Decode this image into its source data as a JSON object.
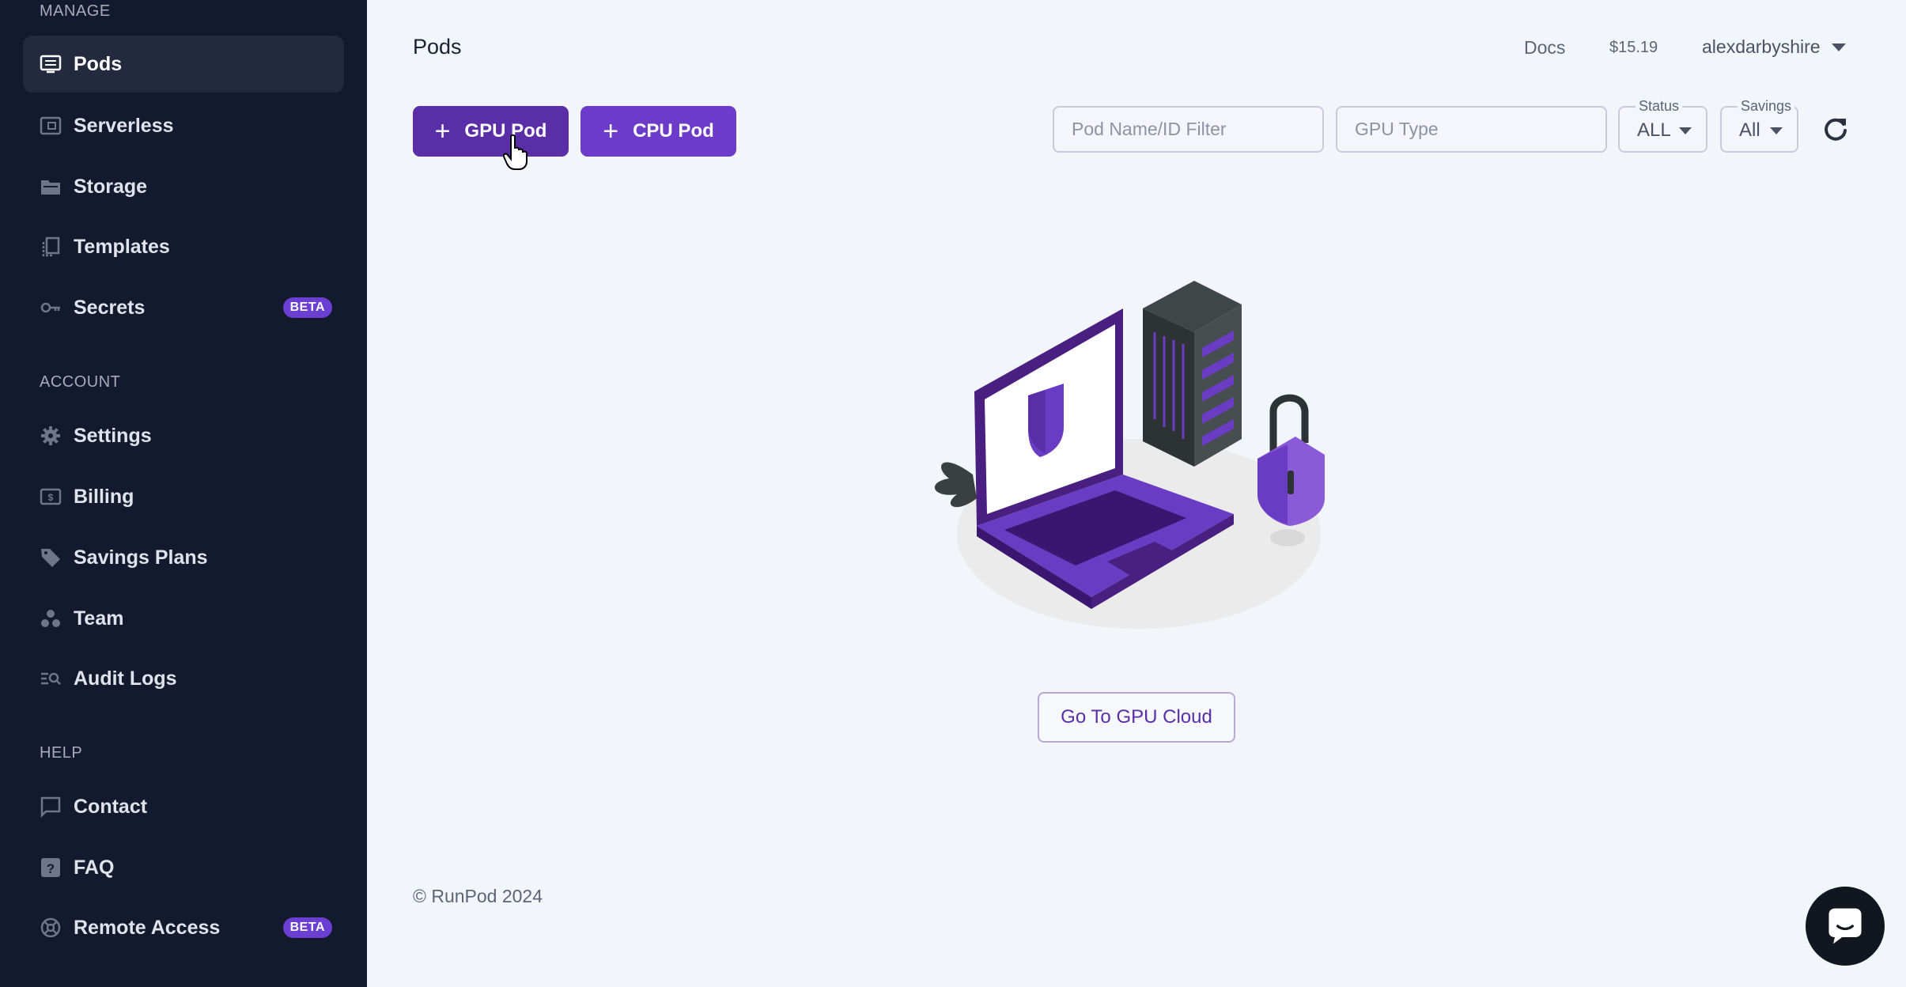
{
  "sidebar": {
    "manage_label": "MANAGE",
    "account_label": "ACCOUNT",
    "help_label": "HELP",
    "items": {
      "pods": {
        "label": "Pods",
        "icon": "pods-icon"
      },
      "serverless": {
        "label": "Serverless",
        "icon": "serverless-icon"
      },
      "storage": {
        "label": "Storage",
        "icon": "storage-icon"
      },
      "templates": {
        "label": "Templates",
        "icon": "templates-icon"
      },
      "secrets": {
        "label": "Secrets",
        "icon": "key-icon",
        "badge": "BETA"
      },
      "settings": {
        "label": "Settings",
        "icon": "gear-icon"
      },
      "billing": {
        "label": "Billing",
        "icon": "billing-icon"
      },
      "savings_plans": {
        "label": "Savings Plans",
        "icon": "tag-icon"
      },
      "team": {
        "label": "Team",
        "icon": "team-icon"
      },
      "audit_logs": {
        "label": "Audit Logs",
        "icon": "audit-logs-icon"
      },
      "contact": {
        "label": "Contact",
        "icon": "chat-icon"
      },
      "faq": {
        "label": "FAQ",
        "icon": "question-icon"
      },
      "remote_access": {
        "label": "Remote Access",
        "icon": "remote-access-icon",
        "badge": "BETA"
      }
    },
    "active": "pods"
  },
  "header": {
    "title": "Pods",
    "docs": "Docs",
    "balance": "$15.19",
    "username": "alexdarbyshire"
  },
  "actions": {
    "plus": "+",
    "gpu_pod": "GPU Pod",
    "cpu_pod": "CPU Pod"
  },
  "filters": {
    "name_placeholder": "Pod Name/ID Filter",
    "name_value": "",
    "gpu_type_placeholder": "GPU Type",
    "gpu_type_value": "",
    "status_label": "Status",
    "status_value": "ALL",
    "savings_label": "Savings",
    "savings_value": "All"
  },
  "empty_state": {
    "button": "Go To GPU Cloud"
  },
  "footer": {
    "copyright": "© RunPod 2024"
  },
  "colors": {
    "sidebar_bg": "#141a2e",
    "accent": "#5a2ea6",
    "accent_light": "#6c3bc9",
    "badge": "#6b3fd1",
    "page_bg": "#f2f5fa"
  }
}
